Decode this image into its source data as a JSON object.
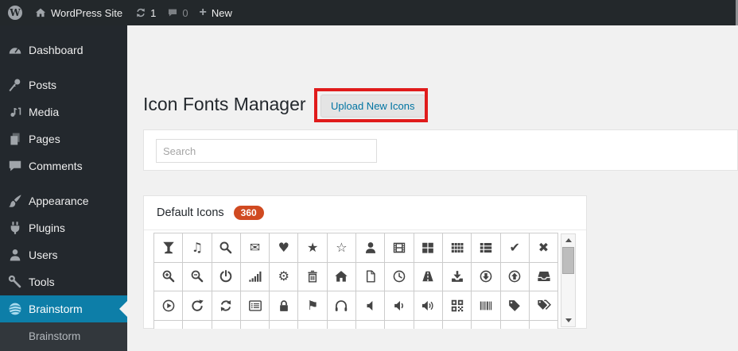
{
  "admin_bar": {
    "wp_logo_letter": "W",
    "site_name": "WordPress Site",
    "update_count": "1",
    "comment_count": "0",
    "new_plus": "+",
    "new_label": "New"
  },
  "sidebar": {
    "items": [
      {
        "id": "dashboard",
        "label": "Dashboard",
        "icon": "dashboard-gauge-icon",
        "active": false,
        "gap": false
      },
      {
        "id": "posts",
        "label": "Posts",
        "icon": "pushpin-icon",
        "active": false,
        "gap": true
      },
      {
        "id": "media",
        "label": "Media",
        "icon": "media-note-icon",
        "active": false,
        "gap": false
      },
      {
        "id": "pages",
        "label": "Pages",
        "icon": "pages-icon",
        "active": false,
        "gap": false
      },
      {
        "id": "comments",
        "label": "Comments",
        "icon": "comment-bubble-icon",
        "active": false,
        "gap": false
      },
      {
        "id": "appearance",
        "label": "Appearance",
        "icon": "paintbrush-icon",
        "active": false,
        "gap": true
      },
      {
        "id": "plugins",
        "label": "Plugins",
        "icon": "plug-icon",
        "active": false,
        "gap": false
      },
      {
        "id": "users",
        "label": "Users",
        "icon": "user-icon",
        "active": false,
        "gap": false
      },
      {
        "id": "tools",
        "label": "Tools",
        "icon": "wrench-icon",
        "active": false,
        "gap": false
      },
      {
        "id": "brainstorm",
        "label": "Brainstorm",
        "icon": "brainstorm-swirl-icon",
        "active": true,
        "gap": false
      }
    ],
    "submenu_items": [
      {
        "id": "brainstorm-sub",
        "label": "Brainstorm"
      }
    ]
  },
  "main": {
    "page_title": "Icon Fonts Manager",
    "upload_button_label": "Upload New Icons",
    "search_placeholder": "Search",
    "default_icons_panel": {
      "title": "Default Icons",
      "badge_count": "360",
      "visible_icons": [
        "martini-glass",
        "music-note",
        "search",
        "envelope",
        "heart",
        "star-filled",
        "star-outline",
        "user",
        "film",
        "grid-large",
        "grid-small",
        "list-grid",
        "check",
        "close",
        "zoom-in",
        "zoom-out",
        "power",
        "signal-bars",
        "gear",
        "trash",
        "home",
        "file",
        "clock",
        "road",
        "download",
        "arrow-circle-down",
        "arrow-circle-up",
        "inbox",
        "play-circle",
        "rotate-right",
        "refresh",
        "list-alt",
        "lock",
        "flag",
        "headphones",
        "volume-mute",
        "volume-low",
        "volume-high",
        "qr-code",
        "barcode",
        "tag",
        "tags"
      ]
    }
  },
  "colors": {
    "active_menu_blue": "#0d7ea8",
    "badge_orange": "#d04a21",
    "annotation_red": "#e01b1b",
    "link_blue": "#0074a2"
  }
}
